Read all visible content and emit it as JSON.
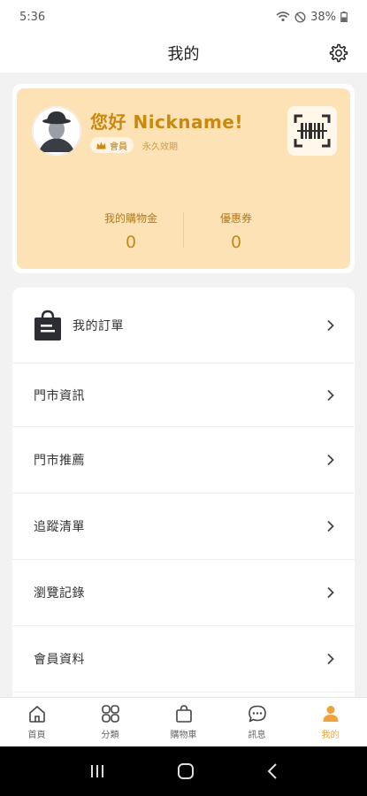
{
  "status_bar": {
    "time": "5:36",
    "battery": "38%"
  },
  "header": {
    "title": "我的"
  },
  "member": {
    "greeting": "您好 Nickname!",
    "level": "會員",
    "validity": "永久效期",
    "stats": [
      {
        "label": "我的購物金",
        "value": "0"
      },
      {
        "label": "優惠券",
        "value": "0"
      }
    ]
  },
  "menu": {
    "items": [
      {
        "label": "我的訂單"
      },
      {
        "label": "門市資訊"
      },
      {
        "label": "門市推薦"
      },
      {
        "label": "追蹤清單"
      },
      {
        "label": "瀏覽記錄"
      },
      {
        "label": "會員資料"
      }
    ]
  },
  "tabbar": {
    "items": [
      {
        "label": "首頁",
        "icon": "home-icon"
      },
      {
        "label": "分類",
        "icon": "category-icon"
      },
      {
        "label": "購物車",
        "icon": "cart-icon"
      },
      {
        "label": "訊息",
        "icon": "message-icon"
      },
      {
        "label": "我的",
        "icon": "person-icon",
        "active": true
      }
    ]
  },
  "colors": {
    "accent": "#f0a23c",
    "card": "#fde2b6",
    "gold_text": "#c9880f"
  }
}
